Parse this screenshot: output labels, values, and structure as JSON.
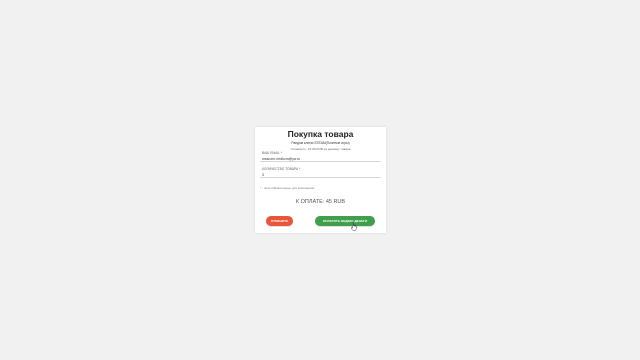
{
  "card": {
    "title": "Покупка товара",
    "subtitle": "Рандом ключи STEAM(Платные игры)",
    "price_line": "Стоимость: 15.00 RUB за единицу товара"
  },
  "form": {
    "email": {
      "label": "ВАШ EMAIL *",
      "value": "mssnzrn.mrdkcm@ya.ru"
    },
    "quantity": {
      "label": "КОЛИЧЕСТВО ТОВАРА *",
      "value": "3"
    },
    "required_note": "* - поля обязательные для заполнения"
  },
  "total": "К ОПЛАТЕ: 45 RUB",
  "buttons": {
    "cancel": "ОТМЕНИТЬ",
    "pay": "ОПЛАТИТЬ ЯНДЕКС.ДЕНЬГИ"
  },
  "icons": {
    "cursor": "hand-pointer-icon"
  }
}
